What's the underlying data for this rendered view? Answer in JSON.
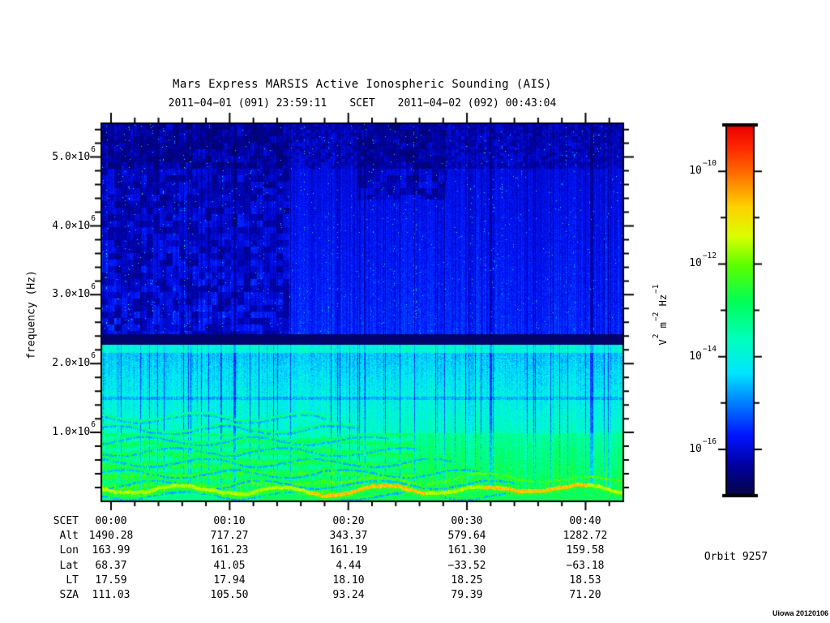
{
  "header": {
    "title": "Mars Express MARSIS Active Ionospheric Sounding (AIS)",
    "start_time": "2011−04−01 (091) 23:59:11",
    "scet_label": "SCET",
    "end_time": "2011−04−02 (092) 00:43:04"
  },
  "y_axis": {
    "label": "frequency (Hz)",
    "ticks": [
      {
        "m": "5.0×10",
        "e": "6"
      },
      {
        "m": "4.0×10",
        "e": "6"
      },
      {
        "m": "3.0×10",
        "e": "6"
      },
      {
        "m": "2.0×10",
        "e": "6"
      },
      {
        "m": "1.0×10",
        "e": "6"
      }
    ]
  },
  "colorbar": {
    "unit_parts": [
      "V",
      "2",
      " m",
      "−2",
      " Hz",
      "−1"
    ],
    "ticks": [
      {
        "m": "10",
        "e": "−10"
      },
      {
        "m": "10",
        "e": "−12"
      },
      {
        "m": "10",
        "e": "−14"
      },
      {
        "m": "10",
        "e": "−16"
      }
    ]
  },
  "ephemeris": {
    "rows": [
      {
        "label": "SCET",
        "values": [
          "00:00",
          "00:10",
          "00:20",
          "00:30",
          "00:40"
        ]
      },
      {
        "label": "Alt",
        "values": [
          "1490.28",
          "717.27",
          "343.37",
          "579.64",
          "1282.72"
        ]
      },
      {
        "label": "Lon",
        "values": [
          "163.99",
          "161.23",
          "161.19",
          "161.30",
          "159.58"
        ]
      },
      {
        "label": "Lat",
        "values": [
          "68.37",
          "41.05",
          "4.44",
          "−33.52",
          "−63.18"
        ]
      },
      {
        "label": "LT",
        "values": [
          "17.59",
          "17.94",
          "18.10",
          "18.25",
          "18.53"
        ]
      },
      {
        "label": "SZA",
        "values": [
          "111.03",
          "105.50",
          "93.24",
          "79.39",
          "71.20"
        ]
      }
    ]
  },
  "footer": {
    "orbit_label": "Orbit 9257",
    "watermark": "Uiowa 20120106"
  },
  "chart_data": {
    "type": "heatmap",
    "title": "Mars Express MARSIS Active Ionospheric Sounding (AIS)",
    "xlabel": "SCET",
    "ylabel": "frequency (Hz)",
    "x": {
      "start_scet": "2011-04-01 (091) 23:59:11",
      "end_scet": "2011-04-02 (092) 00:43:04",
      "duration_min": 44.0,
      "tick_labels": [
        "00:00",
        "00:10",
        "00:20",
        "00:30",
        "00:40"
      ],
      "tick_offsets_min": [
        0.82,
        10.82,
        20.82,
        30.82,
        40.82
      ],
      "minor_step_min": 2
    },
    "y": {
      "min_hz": 0,
      "max_hz": 5490000,
      "major_tick_hz": [
        1000000,
        2000000,
        3000000,
        4000000,
        5000000
      ],
      "minor_step_hz": 200000
    },
    "z": {
      "unit": "V^2 m^-2 Hz^-1",
      "scale": "log",
      "min": 1e-17,
      "max": 1e-09,
      "colormap": "rainbow",
      "labeled_tick_decades": [
        -10,
        -12,
        -14,
        -16
      ]
    },
    "bands": [
      {
        "name": "upper-noise",
        "f_lo_hz": 2430000,
        "f_hi_hz": 5490000,
        "level": 0.115,
        "level_grad": 0.05,
        "desc": "dark blue, strong vertical striping, black patches upper-left and top-center, scattered cyan speckles"
      },
      {
        "name": "absorption-band",
        "f_lo_hz": 2280000,
        "f_hi_hz": 2430000,
        "level": 0.035,
        "desc": "near-black horizontal band across full width"
      },
      {
        "name": "cyan-stripe",
        "f_lo_hz": 2160000,
        "f_hi_hz": 2280000,
        "level": 0.38,
        "desc": "bright cyan stripe just below absorption band"
      },
      {
        "name": "mid",
        "f_lo_hz": 1000000,
        "f_hi_hz": 2160000,
        "level_lo": 0.3,
        "level_hi": 0.4,
        "desc": "blue-cyan with strong vertical striping"
      },
      {
        "name": "lower",
        "f_lo_hz": 0,
        "f_hi_hz": 1000000,
        "level_lo": 0.44,
        "level_hi": 0.54,
        "desc": "cyan-green, wavy harmonic bands on left half, bright yellow echo trace near bottom"
      }
    ],
    "features": {
      "harmonic_line_count": 8,
      "harmonic_spacing_px": 13.5,
      "harmonic_extent_frac": 0.85,
      "trace_level": 0.67,
      "trace_bright_level": 0.79,
      "trace_bright_segments_frac": [
        [
          0.4,
          0.62
        ],
        [
          0.73,
          0.93
        ]
      ],
      "dark_column_fracs": [
        0.255,
        0.745,
        0.94
      ]
    },
    "orbit": 9257
  }
}
